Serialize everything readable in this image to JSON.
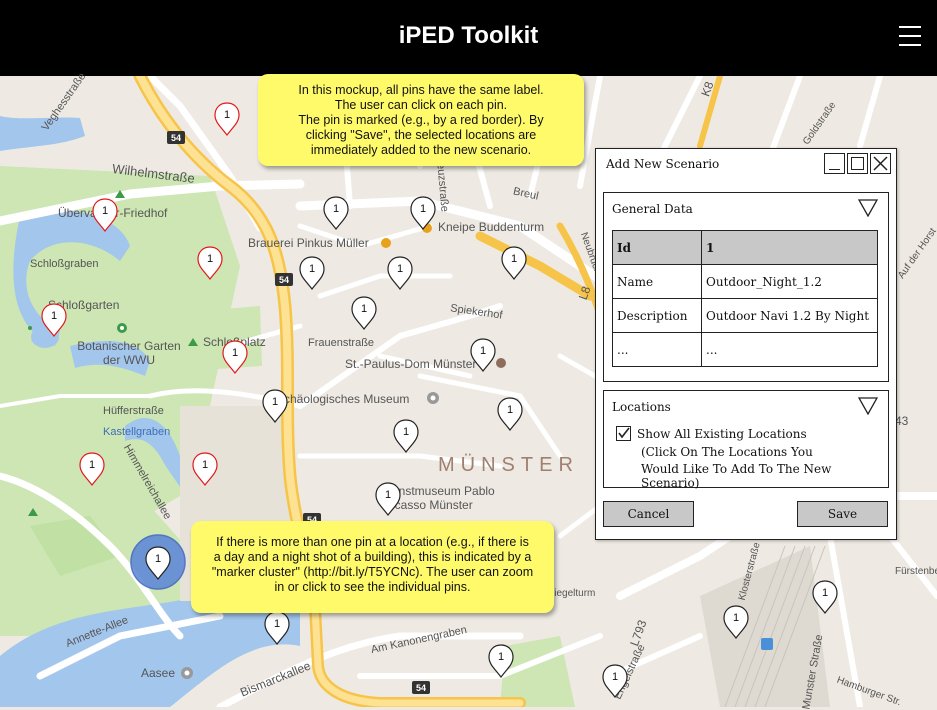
{
  "header": {
    "title": "iPED Toolkit",
    "menu_icon": "hamburger-menu-icon"
  },
  "map": {
    "labels": [
      "Veghesstraße",
      "Wilhelmstraße",
      "Übervasser-Friedhof",
      "Schloßgraben",
      "Schloßgarten",
      "Botanischer Garten der WWU",
      "Schloßplatz",
      "Hüfferstraße",
      "Kastellgraben",
      "Brauerei Pinkus Müller",
      "Frauenstraße",
      "St.-Paulus-Dom Münster",
      "Archäologisches Museum",
      "Kunstmuseum Pablo Picasso Münster",
      "Kneipe Buddenturm",
      "Spiekerhof",
      "MÜNSTER",
      "Aasee",
      "Bismarckallee",
      "Annette-Allee",
      "Am Kanonengraben",
      "Engelstraße",
      "Himmelreichallee",
      "Breul",
      "Goldstraße",
      "Neubrückenstraße",
      "Munster Straße",
      "Auf der Horst",
      "Kreuzstraße",
      "Hamburger Str.",
      "Fürstenbergstr.",
      "Klosterstraße",
      "Spiegelturm",
      "54",
      "54",
      "54",
      "54",
      "L8",
      "L793",
      "K8",
      "43"
    ],
    "pin_label": "1",
    "cluster_label": "1",
    "highlight_color": "#e0191a"
  },
  "notes": {
    "top": [
      "In this mockup, all pins have the same label.",
      "The user can click on each pin.",
      "The pin is marked (e.g., by a red border). By",
      "clicking \"Save\", the selected locations are",
      "immediately added to the new scenario."
    ],
    "bottom": [
      "If there is more than one pin at a location (e.g., if there is",
      "a day and a night shot of a building), this is indicated by a",
      "\"marker cluster\" (http://bit.ly/T5YCNc). The user can zoom",
      "in or click to see the individual pins."
    ]
  },
  "dialog": {
    "title": "Add New Scenario",
    "general_data": {
      "title": "General Data",
      "rows": [
        [
          "Id",
          "1"
        ],
        [
          "Name",
          "Outdoor_Night_1.2"
        ],
        [
          "Description",
          "Outdoor Navi 1.2 By Night"
        ],
        [
          "...",
          "..."
        ]
      ]
    },
    "locations": {
      "title": "Locations",
      "checkbox_checked": true,
      "checkbox_label": "Show All Existing Locations",
      "hint_line1": "(Click On The Locations You",
      "hint_line2": "Would Like To Add To The New Scenario)"
    },
    "cancel_label": "Cancel",
    "save_label": "Save"
  }
}
